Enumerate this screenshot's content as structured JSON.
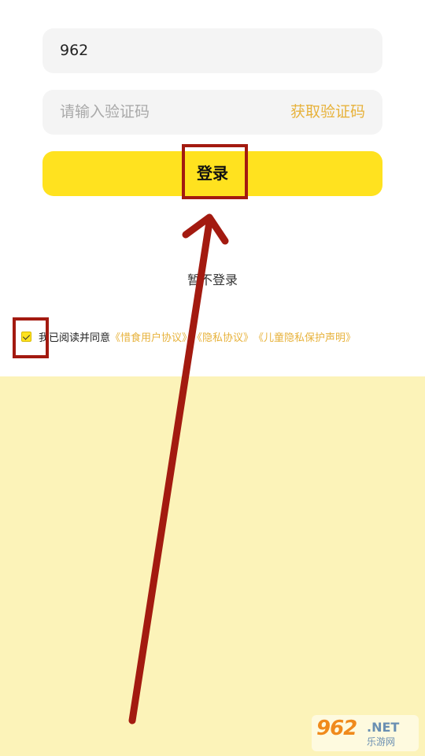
{
  "form": {
    "phone_value": "962",
    "code_placeholder": "请输入验证码",
    "get_code_label": "获取验证码",
    "login_label": "登录",
    "skip_label": "暂不登录"
  },
  "agreement": {
    "checked": true,
    "text": "我已阅读并同意",
    "links": [
      "《惜食用户协议》",
      "《隐私协议》",
      "《儿童隐私保护声明》"
    ]
  },
  "watermark": {
    "digits": "962",
    "suffix": ".NET",
    "subtitle": "乐游网"
  },
  "colors": {
    "accent_yellow": "#ffe21f",
    "link_gold": "#e7b23b",
    "annotation_red": "#a31a10",
    "bottom_background": "#fcf3b9"
  }
}
